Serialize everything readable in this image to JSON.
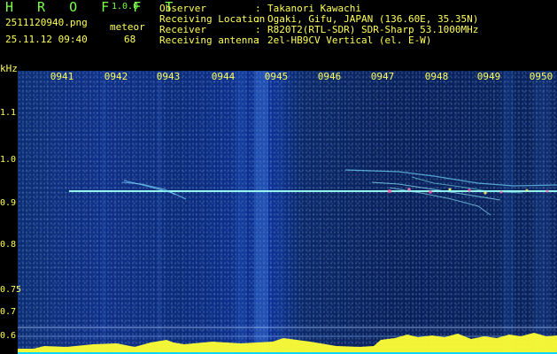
{
  "header": {
    "brand": "H R O F F T",
    "version": "1.0.0",
    "filename": "2511120940.png",
    "mode": "meteor",
    "datetime": "25.11.12 09:40",
    "count": "68",
    "meta": [
      {
        "label": "Observer",
        "sep": ":",
        "value": "Takanori Kawachi"
      },
      {
        "label": "Receiving Location",
        "sep": ":",
        "value": "Ogaki, Gifu, JAPAN (136.60E, 35.35N)"
      },
      {
        "label": "Receiver",
        "sep": ":",
        "value": "R820T2(RTL-SDR) SDR-Sharp 53.1000MHz"
      },
      {
        "label": "Receiving antenna",
        "sep": ":",
        "value": "2el-HB9CV Vertical (el. E-W)"
      }
    ]
  },
  "axis": {
    "unit": "kHz",
    "freq_ticks": [
      "1.1",
      "1.0",
      "0.9",
      "0.8",
      "0.75",
      "0.7",
      "0.6"
    ],
    "time_ticks": [
      "0941",
      "0942",
      "0943",
      "0944",
      "0945",
      "0946",
      "0947",
      "0948",
      "0949",
      "0950"
    ]
  },
  "colors": {
    "text": "#ffff58",
    "brand": "#7dff4a",
    "background": "#000000",
    "signal": "#7dfff1",
    "signal_alt": "#ff4fa3",
    "bottom_band": "#39d9ff",
    "bottom_peaks": "#ffff33"
  }
}
